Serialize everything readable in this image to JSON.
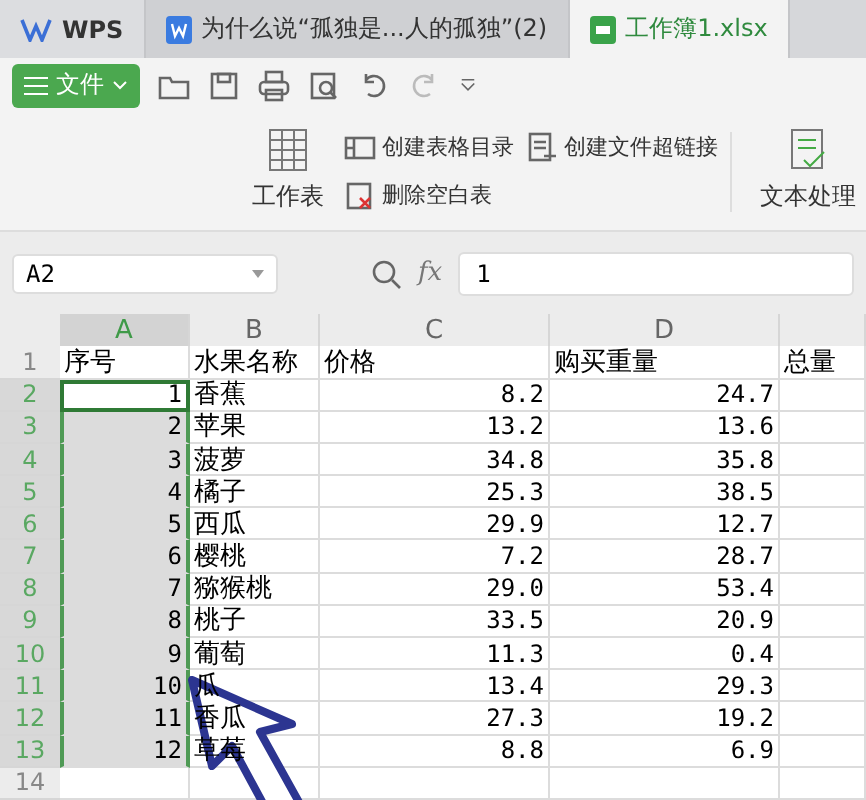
{
  "tabs": [
    {
      "kind": "logo",
      "label": "WPS",
      "selected": false
    },
    {
      "kind": "doc",
      "label": "为什么说“孤独是...人的孤独”(2)",
      "selected": false
    },
    {
      "kind": "sheet",
      "label": "工作簿1.xlsx",
      "selected": true
    }
  ],
  "file_menu": {
    "label": "文件"
  },
  "ribbon": {
    "sheet_button": "工作表",
    "commands": [
      {
        "kind": "catalog",
        "label": "创建表格目录"
      },
      {
        "kind": "link",
        "label": "创建文件超链接"
      },
      {
        "kind": "delete",
        "label": "删除空白表"
      }
    ],
    "text_button": "文本处理"
  },
  "name_box": "A2",
  "fx_label": "fx",
  "formula": "1",
  "columns": [
    {
      "label": "A",
      "selected": true,
      "numeric": true
    },
    {
      "label": "B",
      "selected": false,
      "numeric": false
    },
    {
      "label": "C",
      "selected": false,
      "numeric": true
    },
    {
      "label": "D",
      "selected": false,
      "numeric": true
    }
  ],
  "rows": [
    {
      "number": "1",
      "selected": false,
      "active": false,
      "kind": "header",
      "cells": [
        "序号",
        "水果名称",
        "价格",
        "购买重量",
        "总量"
      ]
    },
    {
      "number": "2",
      "selected": true,
      "active": true,
      "kind": "data",
      "cells": [
        "1",
        "香蕉",
        "8.2",
        "24.7"
      ]
    },
    {
      "number": "3",
      "selected": true,
      "active": false,
      "kind": "data",
      "cells": [
        "2",
        "苹果",
        "13.2",
        "13.6"
      ]
    },
    {
      "number": "4",
      "selected": true,
      "active": false,
      "kind": "data",
      "cells": [
        "3",
        "菠萝",
        "34.8",
        "35.8"
      ]
    },
    {
      "number": "5",
      "selected": true,
      "active": false,
      "kind": "data",
      "cells": [
        "4",
        "橘子",
        "25.3",
        "38.5"
      ]
    },
    {
      "number": "6",
      "selected": true,
      "active": false,
      "kind": "data",
      "cells": [
        "5",
        "西瓜",
        "29.9",
        "12.7"
      ]
    },
    {
      "number": "7",
      "selected": true,
      "active": false,
      "kind": "data",
      "cells": [
        "6",
        "樱桃",
        "7.2",
        "28.7"
      ]
    },
    {
      "number": "8",
      "selected": true,
      "active": false,
      "kind": "data",
      "cells": [
        "7",
        "猕猴桃",
        "29.0",
        "53.4"
      ]
    },
    {
      "number": "9",
      "selected": true,
      "active": false,
      "kind": "data",
      "cells": [
        "8",
        "桃子",
        "33.5",
        "20.9"
      ]
    },
    {
      "number": "10",
      "selected": true,
      "active": false,
      "kind": "data",
      "cells": [
        "9",
        "葡萄",
        "11.3",
        "0.4"
      ]
    },
    {
      "number": "11",
      "selected": true,
      "active": false,
      "kind": "data",
      "cells": [
        "10",
        "瓜",
        "13.4",
        "29.3"
      ]
    },
    {
      "number": "12",
      "selected": true,
      "active": false,
      "kind": "data",
      "cells": [
        "11",
        "香瓜",
        "27.3",
        "19.2"
      ]
    },
    {
      "number": "13",
      "selected": true,
      "active": false,
      "kind": "data",
      "cells": [
        "12",
        "草莓",
        "8.8",
        "6.9"
      ]
    },
    {
      "number": "14",
      "selected": false,
      "active": false,
      "kind": "data",
      "cells": []
    }
  ]
}
